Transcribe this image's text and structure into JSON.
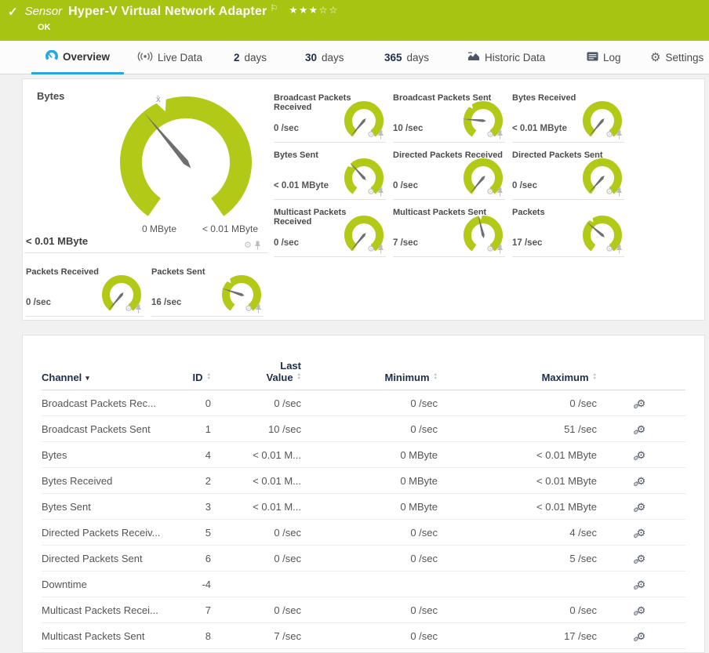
{
  "theme": {
    "header_green": "#a7c412",
    "gauge_green": "#b3c917",
    "accent_blue": "#2ba7df",
    "navy": "#1c2e4a"
  },
  "icons": {
    "gear_glyph": "⚙",
    "caret_down": "▾",
    "sort_up": "▲",
    "sort_down": "▼"
  },
  "header": {
    "check_glyph": "✓",
    "type_label": "Sensor",
    "title": "Hyper-V Virtual Network Adapter",
    "flag_glyph": "⚐",
    "rating_filled": "★★★",
    "rating_empty": "☆☆",
    "rating": "3 of 5",
    "status": "OK"
  },
  "tabs": [
    {
      "label": "Overview",
      "active": true
    },
    {
      "label": "Live Data"
    },
    {
      "num": "2",
      "label": "days"
    },
    {
      "num": "30",
      "label": "days"
    },
    {
      "num": "365",
      "label": "days"
    },
    {
      "label": "Historic Data"
    },
    {
      "label": "Log"
    },
    {
      "label": "Settings"
    }
  ],
  "overview": {
    "primary_gauge": {
      "title": "Bytes",
      "value": "< 0.01 MByte",
      "scale_min": "0 MByte",
      "scale_max": "< 0.01 MByte",
      "avg_label": "x̄",
      "needle_deg": -40,
      "avg_deg": -22
    },
    "gauges": [
      {
        "title": "Broadcast Packets Received",
        "value": "0 /sec",
        "needle_deg": -140
      },
      {
        "title": "Broadcast Packets Sent",
        "value": "10 /sec",
        "needle_deg": -85,
        "avg_deg": -40
      },
      {
        "title": "Bytes Received",
        "value": "< 0.01 MByte",
        "needle_deg": -140
      },
      {
        "title": "Bytes Sent",
        "value": "< 0.01 MByte",
        "needle_deg": -42,
        "avg_deg": -48
      },
      {
        "title": "Directed Packets Received",
        "value": "0 /sec",
        "needle_deg": -140
      },
      {
        "title": "Directed Packets Sent",
        "value": "0 /sec",
        "needle_deg": -138
      },
      {
        "title": "Multicast Packets Received",
        "value": "0 /sec",
        "needle_deg": -140
      },
      {
        "title": "Multicast Packets Sent",
        "value": "7 /sec",
        "needle_deg": -14,
        "avg_deg": -8
      },
      {
        "title": "Packets",
        "value": "17 /sec",
        "needle_deg": -50,
        "avg_deg": -35
      },
      {
        "title": "Packets Received",
        "value": "0 /sec",
        "needle_deg": -140
      },
      {
        "title": "Packets Sent",
        "value": "16 /sec",
        "needle_deg": -72,
        "avg_deg": -42
      }
    ]
  },
  "table": {
    "header": {
      "channel": "Channel",
      "id": "ID",
      "last_line1": "Last",
      "last_line2": "Value",
      "minimum": "Minimum",
      "maximum": "Maximum"
    },
    "rows": [
      {
        "channel": "Broadcast Packets Rec...",
        "id": "0",
        "last": "0 /sec",
        "min": "0 /sec",
        "max": "0 /sec"
      },
      {
        "channel": "Broadcast Packets Sent",
        "id": "1",
        "last": "10 /sec",
        "min": "0 /sec",
        "max": "51 /sec"
      },
      {
        "channel": "Bytes",
        "id": "4",
        "last": "< 0.01 M...",
        "min": "0 MByte",
        "max": "< 0.01 MByte"
      },
      {
        "channel": "Bytes Received",
        "id": "2",
        "last": "< 0.01 M...",
        "min": "0 MByte",
        "max": "< 0.01 MByte"
      },
      {
        "channel": "Bytes Sent",
        "id": "3",
        "last": "< 0.01 M...",
        "min": "0 MByte",
        "max": "< 0.01 MByte"
      },
      {
        "channel": "Directed Packets Receiv...",
        "id": "5",
        "last": "0 /sec",
        "min": "0 /sec",
        "max": "4 /sec"
      },
      {
        "channel": "Directed Packets Sent",
        "id": "6",
        "last": "0 /sec",
        "min": "0 /sec",
        "max": "5 /sec"
      },
      {
        "channel": "Downtime",
        "id": "-4",
        "last": "",
        "min": "",
        "max": ""
      },
      {
        "channel": "Multicast Packets Recei...",
        "id": "7",
        "last": "0 /sec",
        "min": "0 /sec",
        "max": "0 /sec"
      },
      {
        "channel": "Multicast Packets Sent",
        "id": "8",
        "last": "7 /sec",
        "min": "0 /sec",
        "max": "17 /sec"
      }
    ]
  }
}
